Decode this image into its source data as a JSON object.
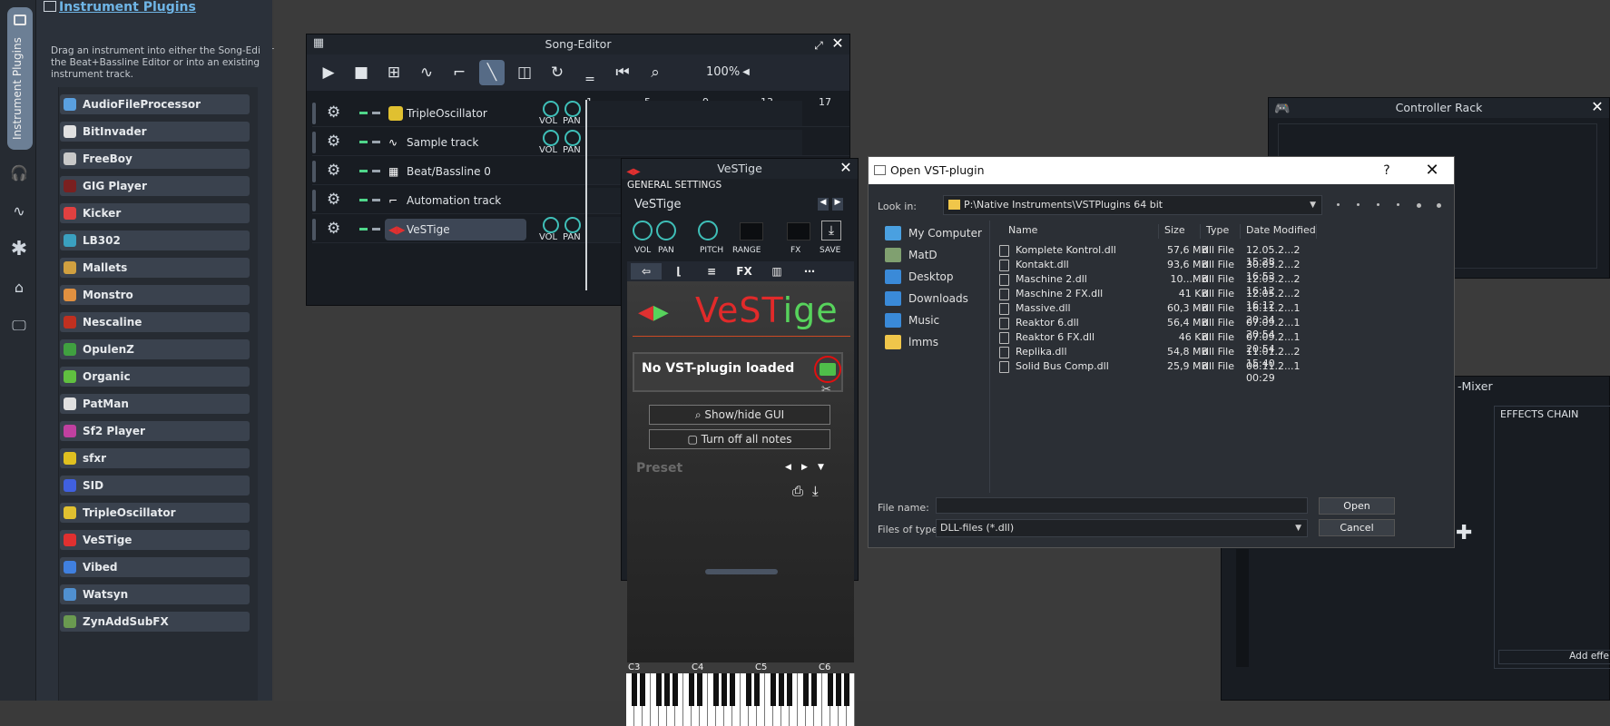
{
  "vtoolbar": {
    "tab_label": "Instrument Plugins"
  },
  "plugin_panel": {
    "title": "Instrument Plugins",
    "description": "Drag an instrument into either the Song-Editor, the Beat+Bassline Editor or into an existing instrument track.",
    "items": [
      {
        "label": "AudioFileProcessor",
        "color": "#5aa0e0"
      },
      {
        "label": "BitInvader",
        "color": "#e0e0e0"
      },
      {
        "label": "FreeBoy",
        "color": "#c8c8c8"
      },
      {
        "label": "GIG Player",
        "color": "#7a2020"
      },
      {
        "label": "Kicker",
        "color": "#e04040"
      },
      {
        "label": "LB302",
        "color": "#3aa0c0"
      },
      {
        "label": "Mallets",
        "color": "#d0a040"
      },
      {
        "label": "Monstro",
        "color": "#e09040"
      },
      {
        "label": "Nescaline",
        "color": "#c03020"
      },
      {
        "label": "OpulenZ",
        "color": "#40a040"
      },
      {
        "label": "Organic",
        "color": "#60c040"
      },
      {
        "label": "PatMan",
        "color": "#e0e0e0"
      },
      {
        "label": "Sf2 Player",
        "color": "#c040a0"
      },
      {
        "label": "sfxr",
        "color": "#e0c020"
      },
      {
        "label": "SID",
        "color": "#4060e0"
      },
      {
        "label": "TripleOscillator",
        "color": "#e0c030"
      },
      {
        "label": "VeSTige",
        "color": "#e03030"
      },
      {
        "label": "Vibed",
        "color": "#4080e0"
      },
      {
        "label": "Watsyn",
        "color": "#5090d0"
      },
      {
        "label": "ZynAddSubFX",
        "color": "#6a9a50"
      }
    ]
  },
  "song_editor": {
    "title": "Song-Editor",
    "zoom": "100%",
    "timeline": [
      "1",
      "5",
      "9",
      "13",
      "17"
    ],
    "tracks": [
      {
        "name": "TripleOscillator",
        "has_knobs": true
      },
      {
        "name": "Sample track",
        "has_knobs": true
      },
      {
        "name": "Beat/Bassline 0",
        "has_knobs": false
      },
      {
        "name": "Automation track",
        "has_knobs": false
      },
      {
        "name": "VeSTige",
        "has_knobs": true
      }
    ],
    "knob_labels": {
      "vol": "VOL",
      "pan": "PAN"
    }
  },
  "vestige": {
    "title": "VeSTige",
    "general": "GENERAL SETTINGS",
    "name": "VeSTige",
    "knob_labels": [
      "VOL",
      "PAN",
      "PITCH",
      "RANGE",
      "FX",
      "SAVE"
    ],
    "tabs": [
      "FX"
    ],
    "logo_a": "VeST",
    "logo_b": "ige",
    "no_plugin": "No VST-plugin loaded",
    "show_hide": "Show/hide GUI",
    "turn_off": "Turn off all notes",
    "preset": "Preset",
    "octaves": [
      "C3",
      "C4",
      "C5",
      "C6"
    ]
  },
  "controller_rack": {
    "title": "Controller Rack"
  },
  "fx_mixer": {
    "title": "-Mixer",
    "effects_chain": "EFFECTS CHAIN",
    "add_effect": "Add effe"
  },
  "dialog": {
    "title": "Open VST-plugin",
    "help": "?",
    "look_in_label": "Look in:",
    "look_in_value": "P:\\Native Instruments\\VSTPlugins 64 bit",
    "places": [
      {
        "label": "My Computer",
        "color": "#4aa0e0"
      },
      {
        "label": "MatD",
        "color": "#80a070"
      },
      {
        "label": "Desktop",
        "color": "#3a8ad8"
      },
      {
        "label": "Downloads",
        "color": "#3a8ad8"
      },
      {
        "label": "Music",
        "color": "#3a8ad8"
      },
      {
        "label": "lmms",
        "color": "#f0c64a"
      }
    ],
    "columns": [
      "Name",
      "Size",
      "Type",
      "Date Modified"
    ],
    "files": [
      {
        "name": "Komplete Kontrol.dll",
        "size": "57,6 MB",
        "type": "dll File",
        "date": "12.05.2...2 15:28"
      },
      {
        "name": "Kontakt.dll",
        "size": "93,6 MB",
        "type": "dll File",
        "date": "30.03.2...2 16:53"
      },
      {
        "name": "Maschine 2.dll",
        "size": "10...MB",
        "type": "dll File",
        "date": "12.05.2...2 16:12"
      },
      {
        "name": "Maschine 2 FX.dll",
        "size": "41 KB",
        "type": "dll File",
        "date": "12.05.2...2 16:12"
      },
      {
        "name": "Massive.dll",
        "size": "60,3 MB",
        "type": "dll File",
        "date": "16.11.2...1 20:34"
      },
      {
        "name": "Reaktor 6.dll",
        "size": "56,4 MB",
        "type": "dll File",
        "date": "07.09.2...1 20:54"
      },
      {
        "name": "Reaktor 6 FX.dll",
        "size": "46 KB",
        "type": "dll File",
        "date": "07.09.2...1 20:54"
      },
      {
        "name": "Replika.dll",
        "size": "54,8 MB",
        "type": "dll File",
        "date": "11.01.2...2 15:40"
      },
      {
        "name": "Solid Bus Comp.dll",
        "size": "25,9 MB",
        "type": "dll File",
        "date": "06.11.2...1 00:29"
      }
    ],
    "file_name_label": "File name:",
    "file_name_value": "",
    "files_of_type_label": "Files of type:",
    "files_of_type_value": "DLL-files (*.dll)",
    "open_label": "Open",
    "cancel_label": "Cancel"
  }
}
